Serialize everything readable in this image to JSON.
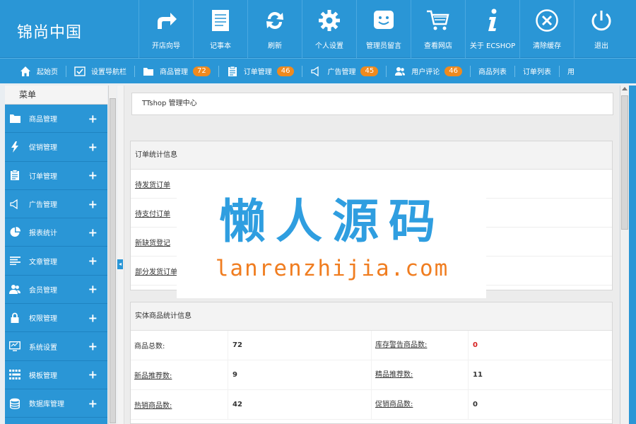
{
  "brand": {
    "logo": "锦尚中国"
  },
  "topnav": [
    {
      "label": "开店向导",
      "icon": "forward-arrow-icon"
    },
    {
      "label": "记事本",
      "icon": "notepad-icon"
    },
    {
      "label": "刷新",
      "icon": "refresh-icon"
    },
    {
      "label": "个人设置",
      "icon": "gear-icon"
    },
    {
      "label": "管理员留言",
      "icon": "smiley-message-icon"
    },
    {
      "label": "查看网店",
      "icon": "cart-icon"
    },
    {
      "label": "关于 ECSHOP",
      "icon": "info-icon"
    },
    {
      "label": "清除缓存",
      "icon": "close-circle-icon"
    },
    {
      "label": "退出",
      "icon": "power-icon"
    }
  ],
  "subnav": [
    {
      "label": "起始页",
      "icon": "home-icon",
      "badge": ""
    },
    {
      "label": "设置导航栏",
      "icon": "checkbox-icon",
      "badge": ""
    },
    {
      "label": "商品管理",
      "icon": "folder-icon",
      "badge": "72"
    },
    {
      "label": "订单管理",
      "icon": "clipboard-icon",
      "badge": "46"
    },
    {
      "label": "广告管理",
      "icon": "speaker-icon",
      "badge": "45"
    },
    {
      "label": "用户评论",
      "icon": "users-icon",
      "badge": "46"
    },
    {
      "label": "商品列表",
      "icon": "",
      "badge": ""
    },
    {
      "label": "订单列表",
      "icon": "",
      "badge": ""
    },
    {
      "label": "用",
      "icon": "",
      "badge": ""
    }
  ],
  "sidebar": {
    "title": "菜单",
    "items": [
      {
        "label": "商品管理",
        "icon": "folder-icon"
      },
      {
        "label": "促销管理",
        "icon": "lightning-icon"
      },
      {
        "label": "订单管理",
        "icon": "clipboard-icon"
      },
      {
        "label": "广告管理",
        "icon": "speaker-icon"
      },
      {
        "label": "报表统计",
        "icon": "pie-chart-icon"
      },
      {
        "label": "文章管理",
        "icon": "text-lines-icon"
      },
      {
        "label": "会员管理",
        "icon": "users-icon"
      },
      {
        "label": "权限管理",
        "icon": "lock-icon"
      },
      {
        "label": "系统设置",
        "icon": "monitor-icon"
      },
      {
        "label": "模板管理",
        "icon": "grid-icon"
      },
      {
        "label": "数据库管理",
        "icon": "database-icon"
      }
    ]
  },
  "breadcrumb": "TTshop 管理中心",
  "orders_panel": {
    "title": "订单统计信息",
    "rows": [
      "待发货订单",
      "待支付订单",
      "新缺货登记",
      "部分发货订单"
    ]
  },
  "goods_panel": {
    "title": "实体商品统计信息",
    "rows": [
      {
        "label": "商品总数:",
        "value": "72",
        "label2": "库存警告商品数:",
        "value2": "0",
        "warn": true
      },
      {
        "label": "新品推荐数:",
        "value": "9",
        "label2": "精品推荐数:",
        "value2": "11",
        "warn": false
      },
      {
        "label": "热销商品数:",
        "value": "42",
        "label2": "促销商品数:",
        "value2": "0",
        "warn": false
      }
    ]
  },
  "watermark": {
    "title": "懒人源码",
    "url": "lanrenzhijia.com"
  },
  "colors": {
    "primary": "#2a96d6",
    "badge": "#f08a1e",
    "warning": "#d62020",
    "watermark_blue": "#2f9ee0",
    "watermark_orange": "#f07d20"
  }
}
